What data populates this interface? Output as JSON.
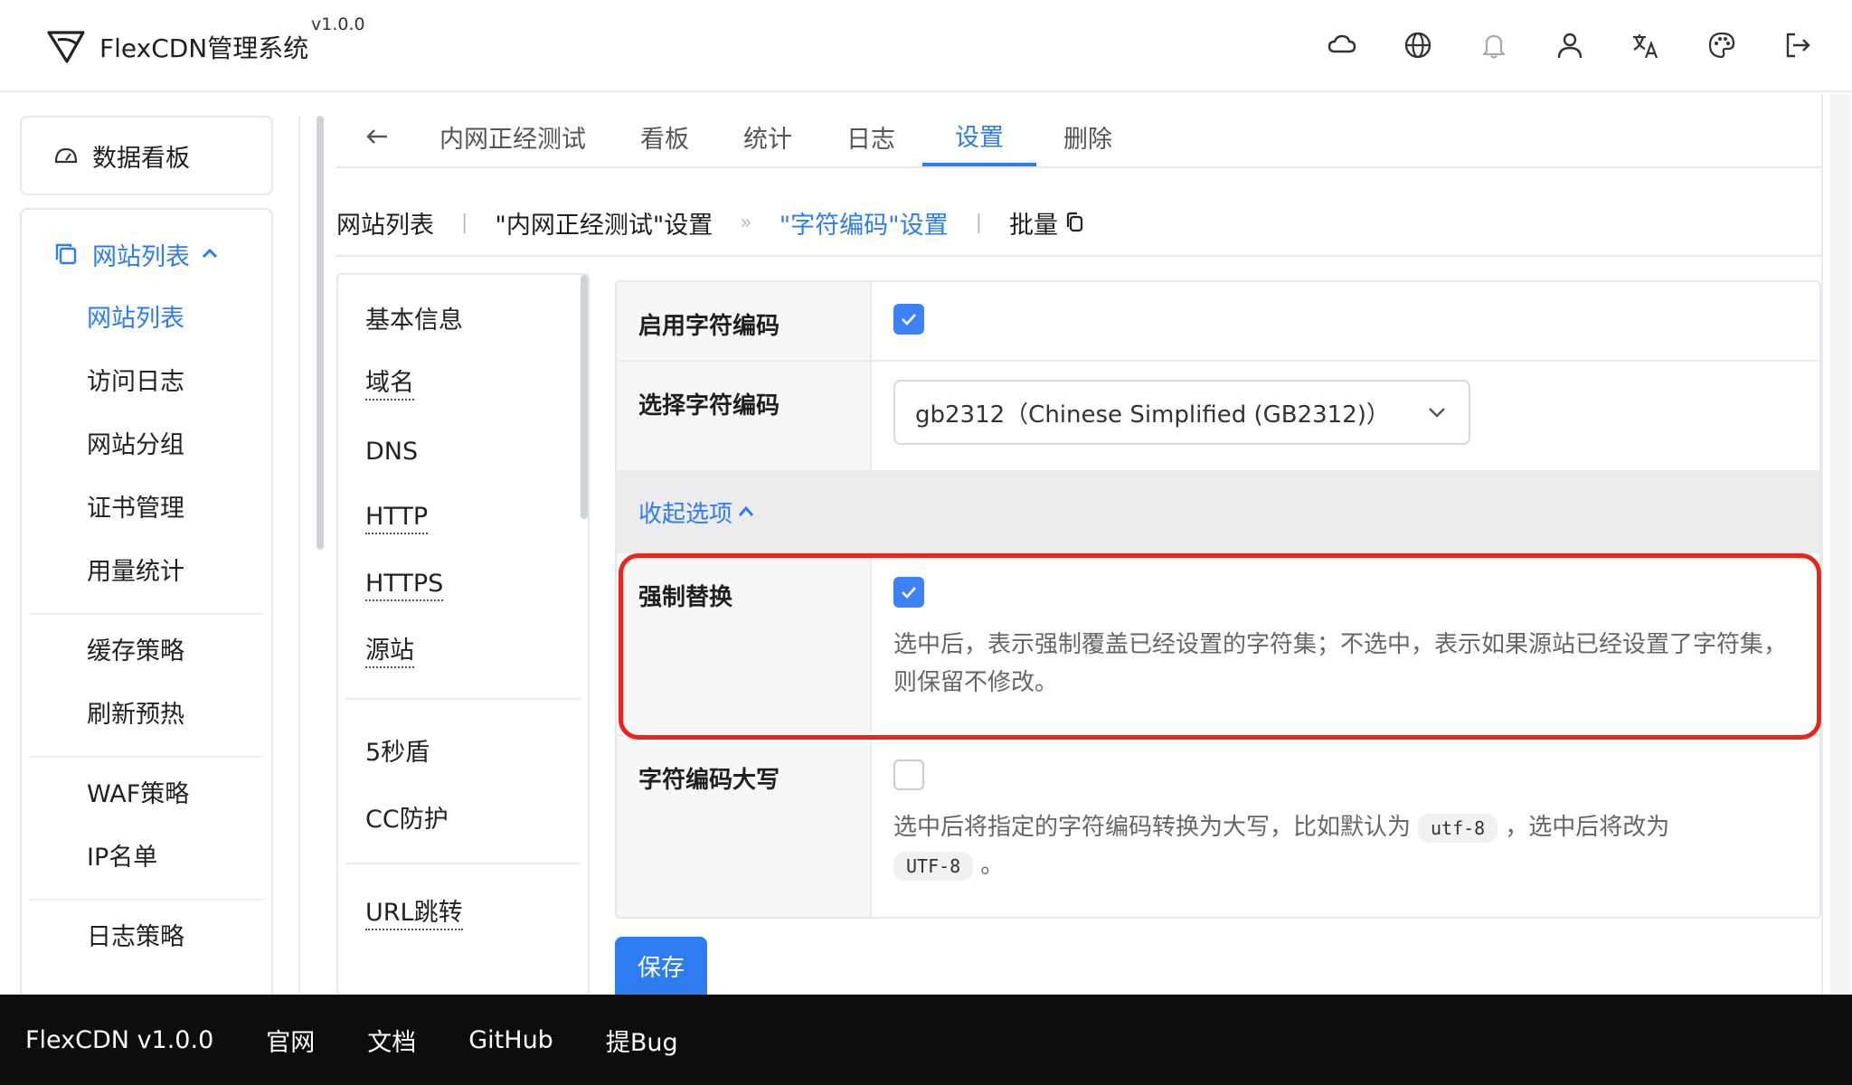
{
  "header": {
    "title": "FlexCDN管理系统",
    "version": "v1.0.0",
    "icons": [
      "cloud-icon",
      "globe-icon",
      "bell-icon",
      "user-icon",
      "translate-icon",
      "palette-icon",
      "logout-icon"
    ]
  },
  "sidebar": {
    "dashboard_label": "数据看板",
    "section_label": "网站列表",
    "items": [
      {
        "label": "网站列表",
        "active": true
      },
      {
        "label": "访问日志"
      },
      {
        "label": "网站分组"
      },
      {
        "label": "证书管理"
      },
      {
        "label": "用量统计"
      },
      {
        "label": "缓存策略"
      },
      {
        "label": "刷新预热"
      },
      {
        "label": "WAF策略"
      },
      {
        "label": "IP名单"
      },
      {
        "label": "日志策略"
      }
    ]
  },
  "tabs": [
    {
      "label": "内网正经测试"
    },
    {
      "label": "看板"
    },
    {
      "label": "统计"
    },
    {
      "label": "日志"
    },
    {
      "label": "设置",
      "active": true
    },
    {
      "label": "删除"
    }
  ],
  "breadcrumb": {
    "root": "网站列表",
    "site": "\"内网正经测试\"设置",
    "current": "\"字符编码\"设置",
    "batch": "批量"
  },
  "submenu": {
    "items": [
      "基本信息",
      "域名",
      "DNS",
      "HTTP",
      "HTTPS",
      "源站",
      "5秒盾",
      "CC防护",
      "URL跳转"
    ]
  },
  "form": {
    "enable_label": "启用字符编码",
    "enable_checked": true,
    "select_label": "选择字符编码",
    "select_value": "gb2312（Chinese Simplified (GB2312)）",
    "collapse_label": "收起选项",
    "force_label": "强制替换",
    "force_checked": true,
    "force_comment": "选中后，表示强制覆盖已经设置的字符集；不选中，表示如果源站已经设置了字符集，则保留不修改。",
    "upper_label": "字符编码大写",
    "upper_checked": false,
    "upper_comment_1": "选中后将指定的字符编码转换为大写，比如默认为",
    "upper_code_1": "utf-8",
    "upper_comment_2": "，选中后将改为",
    "upper_code_2": "UTF-8",
    "upper_comment_3": "。",
    "save_label": "保存"
  },
  "colors": {
    "accent": "#2d7cf0",
    "highlight": "#e8271c",
    "footer_bg": "#0d0d0d"
  },
  "footer": {
    "items": [
      "FlexCDN v1.0.0",
      "官网",
      "文档",
      "GitHub",
      "提Bug"
    ]
  }
}
